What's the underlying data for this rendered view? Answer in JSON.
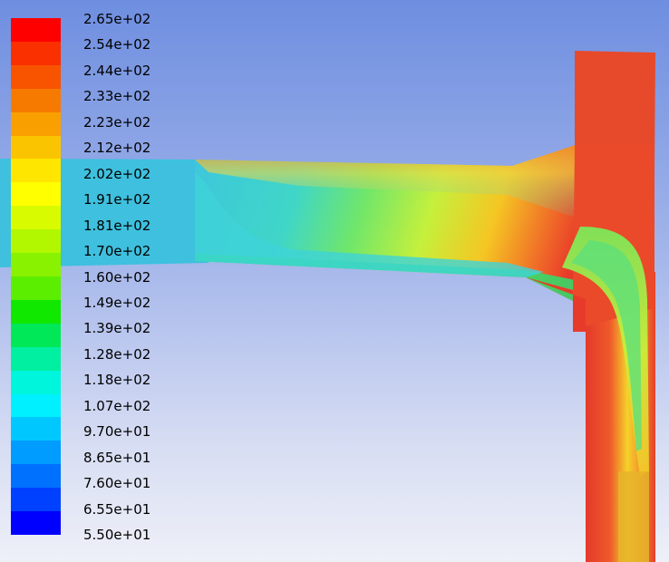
{
  "colorbar": {
    "ticks": [
      "2.65e+02",
      "2.54e+02",
      "2.44e+02",
      "2.33e+02",
      "2.23e+02",
      "2.12e+02",
      "2.02e+02",
      "1.91e+02",
      "1.81e+02",
      "1.70e+02",
      "1.60e+02",
      "1.49e+02",
      "1.39e+02",
      "1.28e+02",
      "1.18e+02",
      "1.07e+02",
      "9.70e+01",
      "8.65e+01",
      "7.60e+01",
      "6.55e+01",
      "5.50e+01"
    ],
    "colors": [
      "#ff0000",
      "#fa3000",
      "#f85400",
      "#f77a00",
      "#f9a000",
      "#fbc400",
      "#ffe600",
      "#ffff00",
      "#d8fb00",
      "#b2f700",
      "#88f200",
      "#5cee00",
      "#10e800",
      "#00e858",
      "#00efa0",
      "#00f6dc",
      "#00f0ff",
      "#00c8ff",
      "#009cff",
      "#0070ff",
      "#0040ff",
      "#0000ff"
    ]
  }
}
